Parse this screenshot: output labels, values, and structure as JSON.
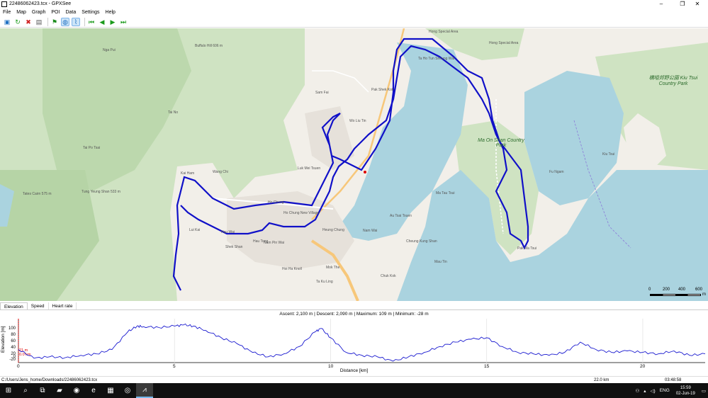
{
  "window": {
    "title": "22486062423.tcx - GPXSee",
    "minimize": "–",
    "maximize": "❐",
    "close": "✕"
  },
  "menu": [
    "File",
    "Map",
    "Graph",
    "POI",
    "Data",
    "Settings",
    "Help"
  ],
  "toolbar": [
    {
      "name": "open-file-icon",
      "glyph": "▣",
      "color": "#1e6fc2"
    },
    {
      "name": "reload-icon",
      "glyph": "↻",
      "color": "#1a9a1a"
    },
    {
      "name": "close-file-icon",
      "glyph": "✖",
      "color": "#d02020"
    },
    {
      "name": "print-icon",
      "glyph": "▤",
      "color": "#555555"
    },
    {
      "name": "show-pois-icon",
      "glyph": "⚑",
      "color": "#1a8a1a"
    },
    {
      "name": "show-map-icon",
      "glyph": "◍",
      "color": "#1e6fc2"
    },
    {
      "name": "show-graphs-icon",
      "glyph": "⌇",
      "color": "#1e6fc2"
    },
    {
      "name": "first-icon",
      "glyph": "⏮",
      "color": "#1a9a1a"
    },
    {
      "name": "prev-icon",
      "glyph": "◀",
      "color": "#1a9a1a"
    },
    {
      "name": "next-icon",
      "glyph": "▶",
      "color": "#1a9a1a"
    },
    {
      "name": "last-icon",
      "glyph": "⏭",
      "color": "#1a9a1a"
    }
  ],
  "map": {
    "labels": [
      {
        "text": "Hong Special Area",
        "cls": ""
      },
      {
        "text": "Hong Special Area",
        "cls": ""
      },
      {
        "text": "Ta Ho Tun Sheung Wai",
        "cls": ""
      },
      {
        "text": "Ma On Shan Country Park",
        "cls": "big"
      },
      {
        "text": "橋咀郊野公園 Kiu Tsui Country Park",
        "cls": "big"
      },
      {
        "text": "Kai Ham",
        "cls": ""
      },
      {
        "text": "Wang Chi",
        "cls": ""
      },
      {
        "text": "Ho Chung",
        "cls": ""
      },
      {
        "text": "Luk Mei Tsuen",
        "cls": ""
      },
      {
        "text": "Ho Chung New Village",
        "cls": ""
      },
      {
        "text": "Heung Chung",
        "cls": ""
      },
      {
        "text": "Nam Wai",
        "cls": ""
      },
      {
        "text": "Au Tsai Tsuen",
        "cls": ""
      },
      {
        "text": "Cheung Kung Shan",
        "cls": ""
      },
      {
        "text": "Chuk Kok",
        "cls": ""
      },
      {
        "text": "Mau Tin",
        "cls": ""
      },
      {
        "text": "Pak Ma Tsui",
        "cls": ""
      },
      {
        "text": "Ma Tau Tsui",
        "cls": ""
      },
      {
        "text": "Fu Ngam",
        "cls": ""
      },
      {
        "text": "Kiu Tsui",
        "cls": ""
      },
      {
        "text": "Tung Yeung Shan 533 m",
        "cls": ""
      },
      {
        "text": "Tates Cairn 575 m",
        "cls": ""
      },
      {
        "text": "Nga Pui",
        "cls": ""
      },
      {
        "text": "Buffalo Hill 606 m",
        "cls": ""
      },
      {
        "text": "Tai No",
        "cls": ""
      },
      {
        "text": "Tai Po Tsai",
        "cls": ""
      },
      {
        "text": "Lui Kai",
        "cls": ""
      },
      {
        "text": "Hau Wai",
        "cls": ""
      },
      {
        "text": "Shek Shan",
        "cls": ""
      },
      {
        "text": "Nam Pin Wai",
        "cls": ""
      },
      {
        "text": "Hoi Ha Knoll",
        "cls": ""
      },
      {
        "text": "Ta Ku Ling",
        "cls": ""
      },
      {
        "text": "Mok The",
        "cls": ""
      },
      {
        "text": "Hau Tong",
        "cls": ""
      },
      {
        "text": "Sam Fai",
        "cls": ""
      },
      {
        "text": "Pak Shek Kok",
        "cls": ""
      },
      {
        "text": "Wo Liu Tin",
        "cls": ""
      }
    ],
    "scale": {
      "ticks": [
        "0",
        "200",
        "400",
        "600"
      ],
      "unit": "m"
    }
  },
  "graph_tabs": [
    "Elevation",
    "Speed",
    "Heart rate"
  ],
  "graph": {
    "info": "Ascent: 2,100 m  |  Descent: 2,090 m  |  Maximum: 109 m  |  Minimum: -28 m",
    "ylabel": "Elevation [m]",
    "xlabel": "Distance [km]",
    "yticks": [
      "100",
      "80",
      "60",
      "40",
      "20",
      "0",
      "-20"
    ],
    "xticks": [
      "0",
      "5",
      "10",
      "15",
      "20"
    ],
    "marker_top": "21 m",
    "marker_bottom": "0.0 km"
  },
  "chart_data": {
    "type": "line",
    "xlabel": "Distance [km]",
    "ylabel": "Elevation [m]",
    "xlim": [
      0,
      22
    ],
    "ylim": [
      -28,
      109
    ],
    "x": [
      0,
      0.5,
      1,
      1.5,
      2,
      2.5,
      3,
      3.5,
      3.8,
      4,
      4.5,
      5,
      5.3,
      5.6,
      6,
      6.5,
      7,
      7.5,
      8,
      8.5,
      9,
      9.5,
      9.7,
      10,
      10.5,
      11,
      11.5,
      12,
      12.5,
      13,
      13.5,
      14,
      14.5,
      15,
      15.5,
      16,
      16.5,
      17,
      17.5,
      18,
      18.5,
      19,
      19.5,
      20,
      20.5,
      21,
      21.5,
      22
    ],
    "y": [
      20,
      -10,
      -5,
      -8,
      0,
      5,
      20,
      80,
      100,
      98,
      95,
      100,
      104,
      100,
      85,
      60,
      40,
      10,
      -5,
      5,
      30,
      80,
      92,
      60,
      10,
      0,
      -5,
      -20,
      -5,
      10,
      30,
      45,
      55,
      60,
      30,
      10,
      5,
      0,
      10,
      45,
      20,
      10,
      15,
      10,
      5,
      15,
      0,
      5
    ],
    "series": [
      {
        "values_ref": "y",
        "color": "#1a1ad0"
      }
    ]
  },
  "status": {
    "path": "C:/Users/Jens_home/Downloads/22486062423.tcx",
    "distance": "22.0 km",
    "time": "03:48:58"
  },
  "taskbar": {
    "apps": [
      {
        "name": "start-icon",
        "glyph": "⊞"
      },
      {
        "name": "search-icon",
        "glyph": "⌕"
      },
      {
        "name": "task-view-icon",
        "glyph": "⧉"
      },
      {
        "name": "file-explorer-icon",
        "glyph": "▰"
      },
      {
        "name": "firefox-icon",
        "glyph": "◉"
      },
      {
        "name": "edge-icon",
        "glyph": "e"
      },
      {
        "name": "store-icon",
        "glyph": "▦"
      },
      {
        "name": "chrome-icon",
        "glyph": "◎"
      },
      {
        "name": "gpxsee-icon",
        "glyph": "⩘"
      }
    ],
    "language": "ENG",
    "time": "15:59",
    "date": "02-Jun-19"
  }
}
